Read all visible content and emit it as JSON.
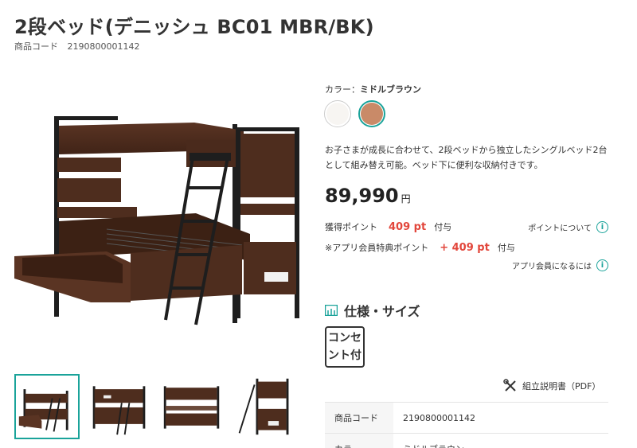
{
  "product": {
    "title": "2段ベッド(デニッシュ BC01 MBR/BK)",
    "code_label": "商品コード",
    "code_value": "2190800001142"
  },
  "color": {
    "label": "カラー：",
    "selected_name": "ミドルブラウン",
    "swatches": [
      {
        "name": "white",
        "hex": "#f7f5f2"
      },
      {
        "name": "brown",
        "hex": "#c98a68"
      }
    ]
  },
  "description": "お子さまが成長に合わせて、2段ベッドから独立したシングルベッド2台として組み替え可能。ベッド下に便利な収納付きです。",
  "price": {
    "amount": "89,990",
    "unit": "円"
  },
  "points": {
    "earned_label": "獲得ポイント",
    "earned_value": "409 pt",
    "suffix": "付与",
    "about_link": "ポイントについて",
    "app_label": "※アプリ会員特典ポイント",
    "app_value": "+ 409 pt",
    "app_suffix": "付与",
    "app_link": "アプリ会員になるには"
  },
  "spec": {
    "title": "仕様・サイズ",
    "badge": "コンセント付",
    "manual_link": "組立説明書（PDF）",
    "rows": [
      {
        "key": "商品コード",
        "value": "2190800001142"
      },
      {
        "key": "カラー",
        "value": "ミドルブラウン"
      }
    ]
  },
  "colors": {
    "accent": "#1aa39a",
    "point_red": "#e2463b",
    "wood": "#4a2a1c",
    "frame": "#1e1e1e"
  }
}
